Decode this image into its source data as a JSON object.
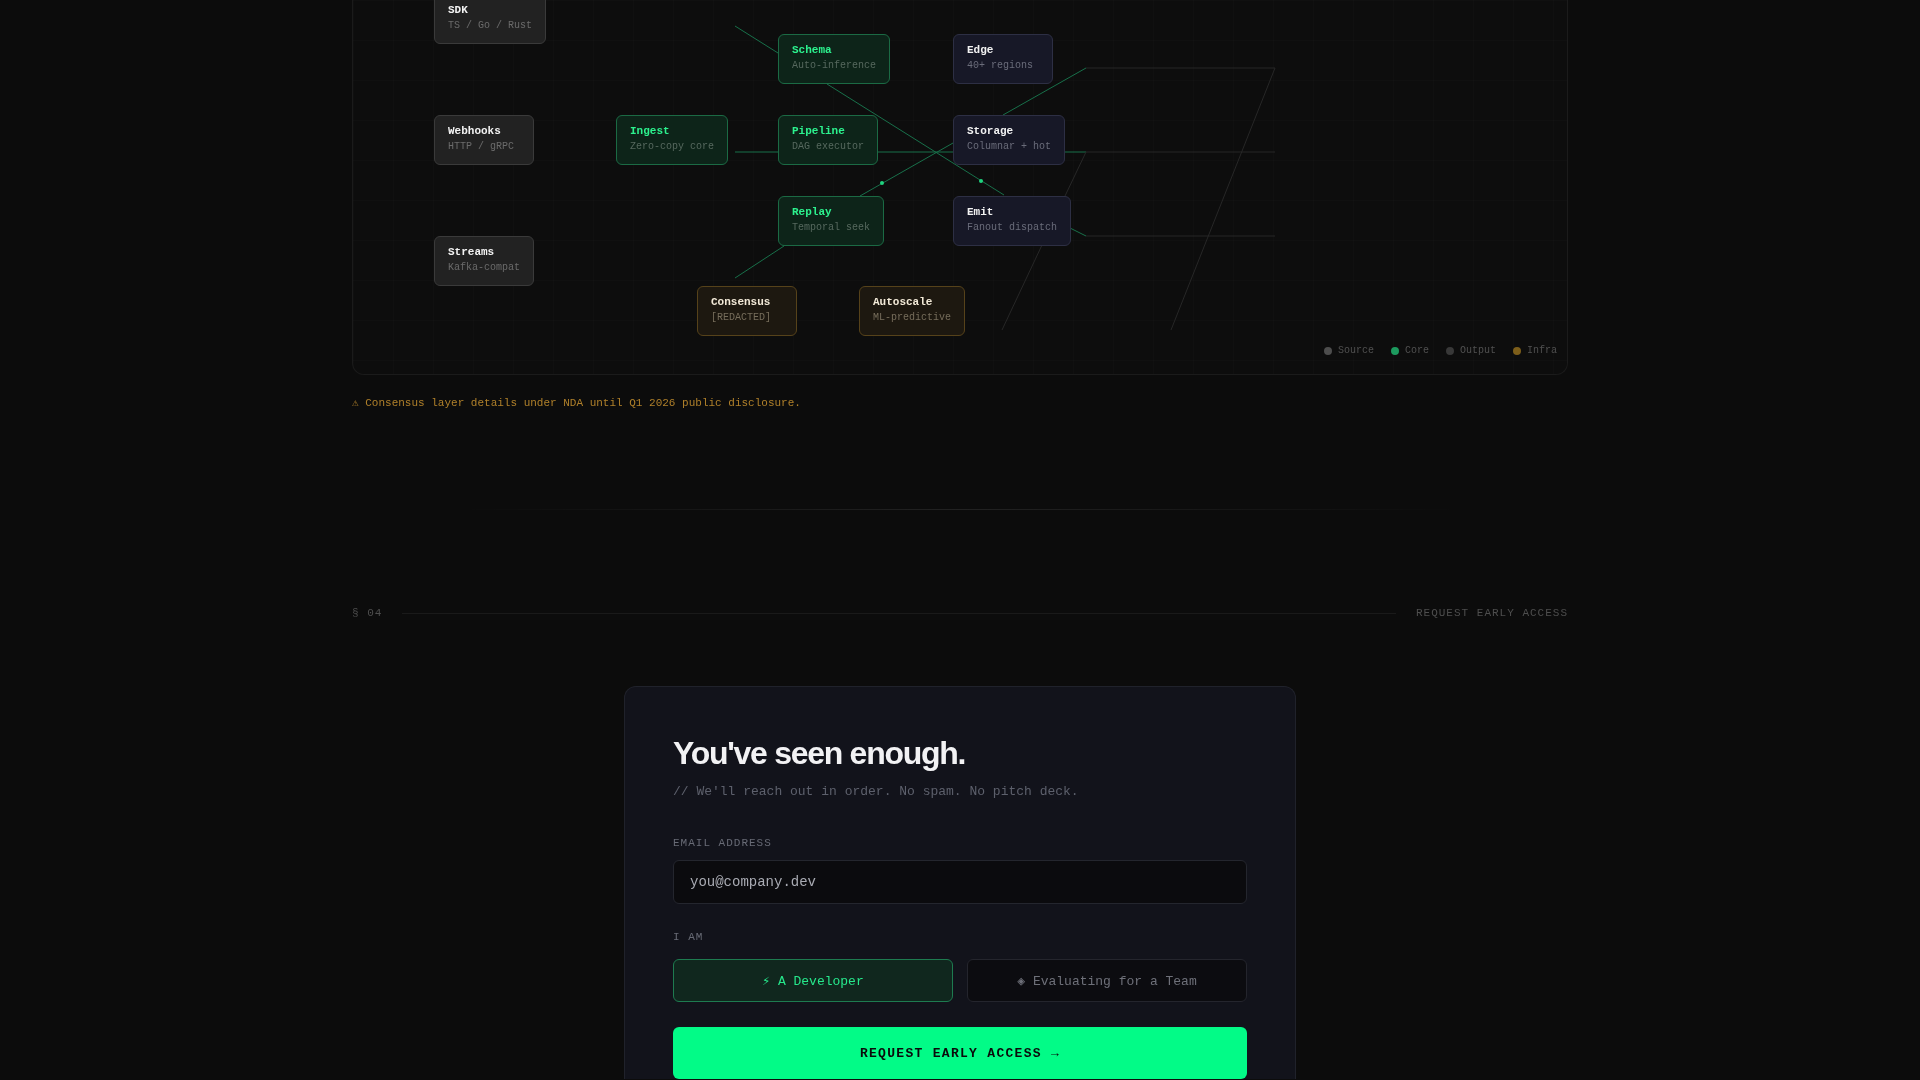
{
  "diagram": {
    "nodes": [
      {
        "title": "SDK",
        "subtitle": "TS / Go / Rust",
        "kind": "source"
      },
      {
        "title": "Schema",
        "subtitle": "Auto-inference",
        "kind": "core"
      },
      {
        "title": "Edge",
        "subtitle": "40+ regions",
        "kind": "output"
      },
      {
        "title": "Webhooks",
        "subtitle": "HTTP / gRPC",
        "kind": "source"
      },
      {
        "title": "Ingest",
        "subtitle": "Zero-copy core",
        "kind": "core"
      },
      {
        "title": "Pipeline",
        "subtitle": "DAG executor",
        "kind": "core"
      },
      {
        "title": "Storage",
        "subtitle": "Columnar + hot",
        "kind": "output"
      },
      {
        "title": "Replay",
        "subtitle": "Temporal seek",
        "kind": "core"
      },
      {
        "title": "Emit",
        "subtitle": "Fanout dispatch",
        "kind": "output"
      },
      {
        "title": "Streams",
        "subtitle": "Kafka-compat",
        "kind": "source"
      },
      {
        "title": "Consensus",
        "subtitle": "[REDACTED]",
        "kind": "infra"
      },
      {
        "title": "Autoscale",
        "subtitle": "ML-predictive",
        "kind": "infra"
      }
    ],
    "legend": [
      {
        "label": "Source",
        "color": "#4d4d4d"
      },
      {
        "label": "Core",
        "color": "#1c9a5e"
      },
      {
        "label": "Output",
        "color": "#383838"
      },
      {
        "label": "Infra",
        "color": "#7d5e1a"
      }
    ]
  },
  "notice": "⚠ Consensus layer details under NDA until Q1 2026 public disclosure.",
  "section": {
    "number": "§ 04",
    "title": "REQUEST EARLY ACCESS"
  },
  "signup": {
    "title": "You've seen enough.",
    "subtitle": "// We'll reach out in order. No spam. No pitch deck.",
    "email": {
      "label": "EMAIL ADDRESS",
      "placeholder": "you@company.dev"
    },
    "role": {
      "label": "I AM",
      "options": [
        {
          "label": "⚡ A Developer",
          "selected": true
        },
        {
          "label": "◈ Evaluating for a Team",
          "selected": false
        }
      ]
    },
    "submit": "REQUEST EARLY ACCESS →"
  }
}
